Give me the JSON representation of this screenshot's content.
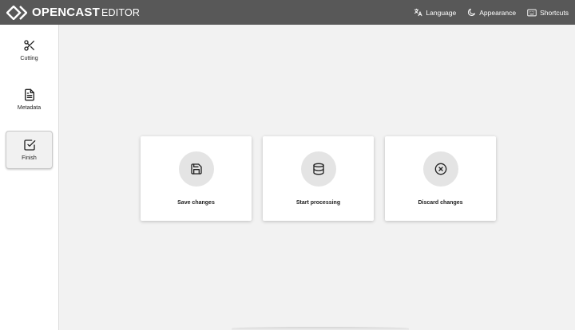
{
  "header": {
    "logo_main": "OPENCAST",
    "logo_sub": "EDITOR",
    "nav": [
      {
        "label": "Language",
        "icon": "translate-icon"
      },
      {
        "label": "Appearance",
        "icon": "moon-icon"
      },
      {
        "label": "Shortcuts",
        "icon": "keyboard-icon"
      }
    ]
  },
  "sidebar": {
    "items": [
      {
        "label": "Cutting",
        "icon": "scissors-icon"
      },
      {
        "label": "Metadata",
        "icon": "document-icon"
      },
      {
        "label": "Finish",
        "icon": "checkbox-icon",
        "active": true
      }
    ]
  },
  "main": {
    "actions": [
      {
        "label": "Save changes",
        "icon": "save-icon"
      },
      {
        "label": "Start processing",
        "icon": "database-icon"
      },
      {
        "label": "Discard changes",
        "icon": "x-circle-icon"
      }
    ]
  },
  "colors": {
    "header_bg": "#585858",
    "page_bg": "#f2f2f2",
    "card_bg": "#ffffff",
    "icon_circle": "#e4e4e4"
  }
}
